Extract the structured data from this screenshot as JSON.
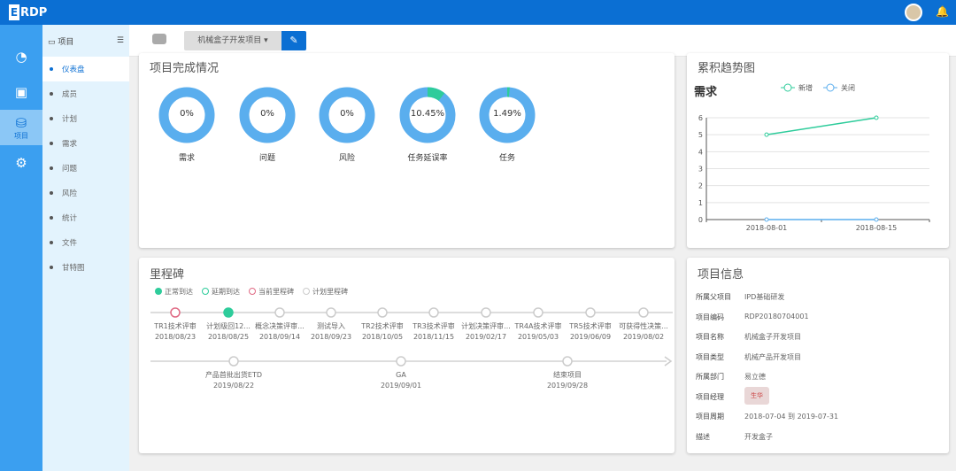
{
  "app": {
    "logo": "RDP",
    "logo_mark": "E"
  },
  "rail": [
    {
      "icon": "dashboard-icon"
    },
    {
      "icon": "screen-icon"
    },
    {
      "icon": "project-icon",
      "label": "项目"
    },
    {
      "icon": "settings-icon"
    }
  ],
  "sidebar": {
    "header": "项目",
    "items": [
      "仪表盘",
      "成员",
      "计划",
      "需求",
      "问题",
      "风险",
      "统计",
      "文件",
      "甘特图"
    ]
  },
  "subheader": {
    "project_select": "机械盒子开发项目 ▾"
  },
  "completion": {
    "title": "项目完成情况",
    "donuts": [
      {
        "label": "需求",
        "value": "0%",
        "pct": 0
      },
      {
        "label": "问题",
        "value": "0%",
        "pct": 0
      },
      {
        "label": "风险",
        "value": "0%",
        "pct": 0
      },
      {
        "label": "任务延误率",
        "value": "10.45%",
        "pct": 10.45
      },
      {
        "label": "任务",
        "value": "1.49%",
        "pct": 1.49
      }
    ],
    "colors": {
      "track": "#5aaeee",
      "fill": "#2ecc9b"
    }
  },
  "trend": {
    "title": "累积趋势图"
  },
  "chart_data": {
    "type": "line",
    "title": "需求",
    "categories": [
      "2018-08-01",
      "2018-08-15"
    ],
    "series": [
      {
        "name": "新增",
        "values": [
          5,
          6
        ],
        "color": "#2ecc9b"
      },
      {
        "name": "关闭",
        "values": [
          0,
          0
        ],
        "color": "#5aaeee"
      }
    ],
    "ylim": [
      0,
      6
    ],
    "yticks": [
      0,
      1,
      2,
      3,
      4,
      5,
      6
    ],
    "grid": true,
    "legend": "top"
  },
  "milestones": {
    "title": "里程碑",
    "legend": [
      {
        "label": "正常到达",
        "color": "#2ecc9b",
        "filled": true
      },
      {
        "label": "延期到达",
        "color": "#2ecc9b",
        "filled": false
      },
      {
        "label": "当前里程碑",
        "color": "#e06b85",
        "filled": false
      },
      {
        "label": "计划里程碑",
        "color": "#ccc",
        "filled": false
      }
    ],
    "row1": [
      {
        "name": "TR1技术评审",
        "date": "2018/08/23",
        "status": "current"
      },
      {
        "name": "计划级回12...",
        "date": "2018/08/25",
        "status": "normal"
      },
      {
        "name": "概念决策评审...",
        "date": "2018/09/14",
        "status": "plan"
      },
      {
        "name": "测试导入",
        "date": "2018/09/23",
        "status": "plan"
      },
      {
        "name": "TR2技术评审",
        "date": "2018/10/05",
        "status": "plan"
      },
      {
        "name": "TR3技术评审",
        "date": "2018/11/15",
        "status": "plan"
      },
      {
        "name": "计划决策评审...",
        "date": "2019/02/17",
        "status": "plan"
      },
      {
        "name": "TR4A技术评审",
        "date": "2019/05/03",
        "status": "plan"
      },
      {
        "name": "TR5技术评审",
        "date": "2019/06/09",
        "status": "plan"
      },
      {
        "name": "可获得性决策...",
        "date": "2019/08/02",
        "status": "plan"
      }
    ],
    "row2": [
      {
        "name": "产品首批出货ETD",
        "date": "2019/08/22",
        "status": "plan"
      },
      {
        "name": "GA",
        "date": "2019/09/01",
        "status": "plan"
      },
      {
        "name": "结束项目",
        "date": "2019/09/28",
        "status": "plan"
      }
    ]
  },
  "info": {
    "title": "项目信息",
    "rows": [
      {
        "k": "所属父项目",
        "v": "IPD基础研发"
      },
      {
        "k": "项目编码",
        "v": "RDP20180704001"
      },
      {
        "k": "项目名称",
        "v": "机械盒子开发项目"
      },
      {
        "k": "项目类型",
        "v": "机械产品开发项目"
      },
      {
        "k": "所属部门",
        "v": "易立德"
      },
      {
        "k": "项目经理",
        "v": "",
        "avatar": "生华"
      },
      {
        "k": "项目周期",
        "v": "2018-07-04 到 2019-07-31"
      },
      {
        "k": "描述",
        "v": "开发盒子"
      }
    ]
  }
}
